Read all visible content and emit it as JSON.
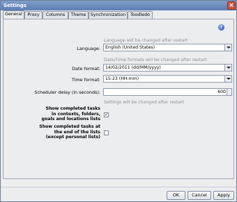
{
  "window": {
    "title": "Settings",
    "close_icon": "close-icon"
  },
  "tabs": [
    {
      "label": "General",
      "active": true
    },
    {
      "label": "Proxy"
    },
    {
      "label": "Columns"
    },
    {
      "label": "Theme"
    },
    {
      "label": "Synchronization"
    },
    {
      "label": "Toodledo"
    }
  ],
  "help": {
    "icon": "help-icon",
    "glyph": "?"
  },
  "notes": {
    "language": "Language will be changed after restart",
    "datetime": "Date/Time formats will be changed after restart",
    "settings": "Settings will be changed after restart"
  },
  "fields": {
    "language_label": "Language:",
    "language_value": "English (United States)",
    "date_label": "Date format:",
    "date_value": "14/02/2011 (dd/MM/yyyy)",
    "time_label": "Time format:",
    "time_value": "15:23 (HH:mm)",
    "scheduler_label": "Scheduler delay (in seconds):",
    "scheduler_value": "600"
  },
  "checks": {
    "completed_contexts_label": [
      "Show completed tasks",
      "in contexts, folders,",
      "goals and locations lists"
    ],
    "completed_contexts_checked": true,
    "completed_end_label": [
      "Show completed tasks at",
      "the end of the lists",
      "(except personal lists)"
    ],
    "completed_end_checked": false
  },
  "buttons": {
    "ok": "OK",
    "cancel": "Cancel",
    "apply": "Apply"
  }
}
